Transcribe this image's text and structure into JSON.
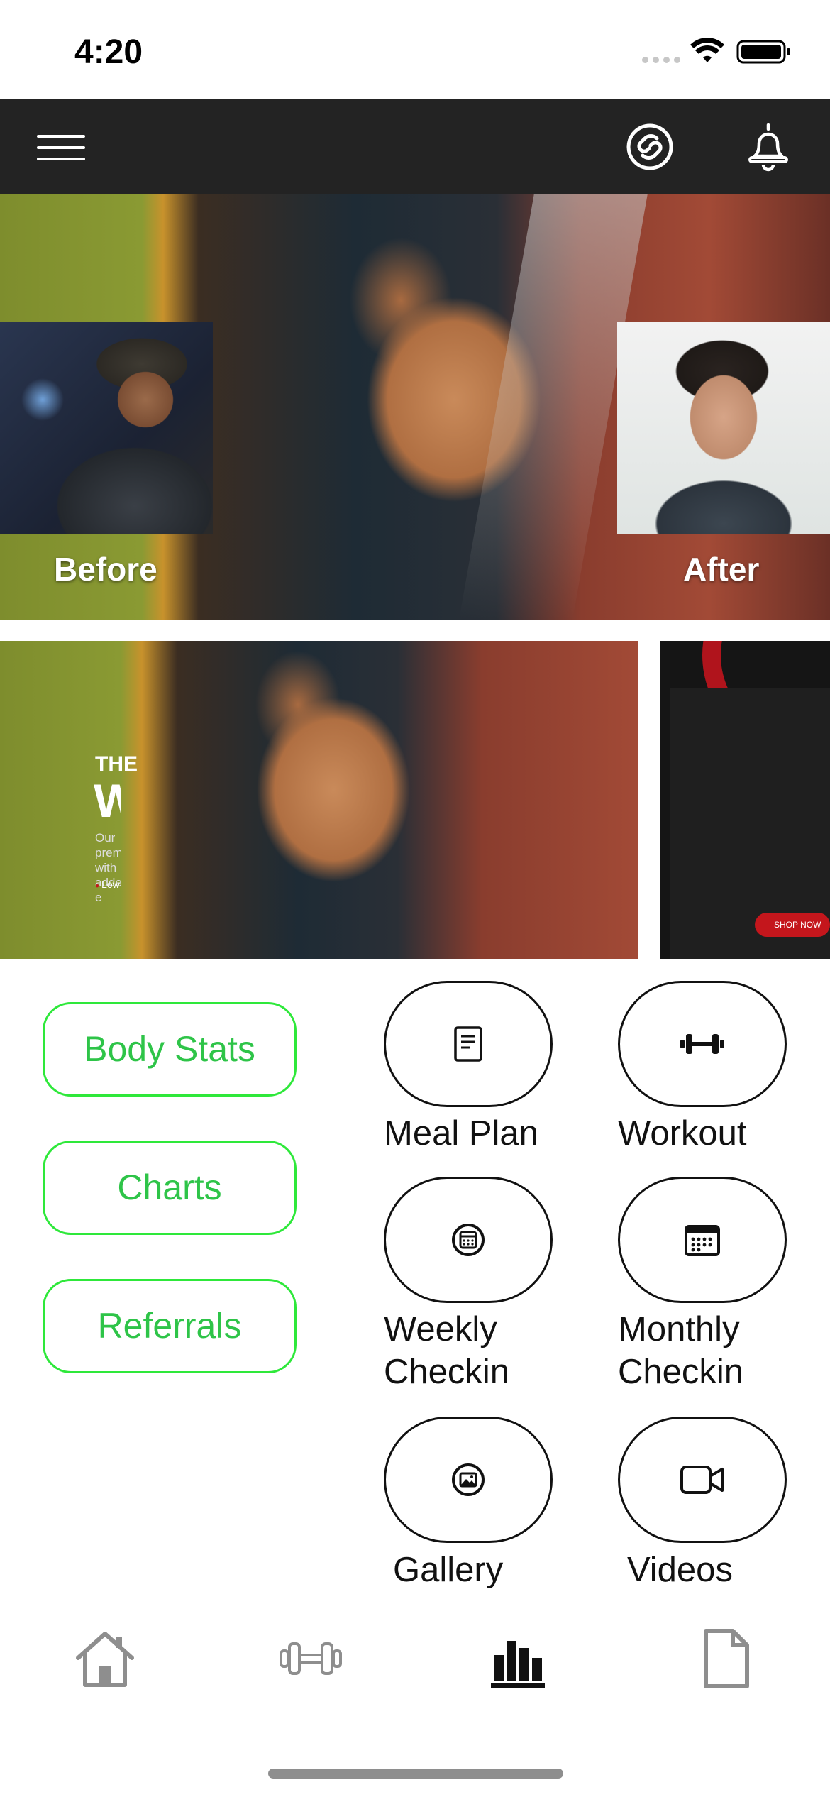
{
  "status_bar": {
    "time": "4:20"
  },
  "header": {
    "menu_icon": "hamburger-menu-icon",
    "brand_icon": "brand-logo-icon",
    "notification_icon": "bell-icon"
  },
  "hero": {
    "before_label": "Before",
    "after_label": "After"
  },
  "banners": {
    "promo": {
      "title_small": "THE",
      "title_big": "WHEY",
      "description": "Our premium\nwith added e",
      "bullets": [
        "Low Sugar",
        "V"
      ],
      "cta": "SHOP NOW"
    }
  },
  "left_buttons": [
    {
      "label": "Body Stats"
    },
    {
      "label": "Charts"
    },
    {
      "label": "Referrals"
    }
  ],
  "tiles": [
    {
      "label": "Meal Plan",
      "icon": "document-icon"
    },
    {
      "label": "Workout",
      "icon": "dumbbell-icon"
    },
    {
      "label": "Weekly\nCheckin",
      "icon": "calendar-circle-icon"
    },
    {
      "label": "Monthly\nCheckin",
      "icon": "calendar-icon"
    },
    {
      "label": "Gallery",
      "icon": "image-icon"
    },
    {
      "label": "Videos",
      "icon": "video-camera-icon"
    }
  ],
  "bottom_nav": {
    "items": [
      {
        "icon": "home-icon",
        "active": false
      },
      {
        "icon": "dumbbell-icon",
        "active": false
      },
      {
        "icon": "bar-chart-icon",
        "active": true
      },
      {
        "icon": "file-icon",
        "active": false
      }
    ]
  },
  "colors": {
    "header_bg": "#232323",
    "accent_green": "#2ee83a",
    "accent_green_text": "#2ec448",
    "promo_red": "#c4161c"
  }
}
